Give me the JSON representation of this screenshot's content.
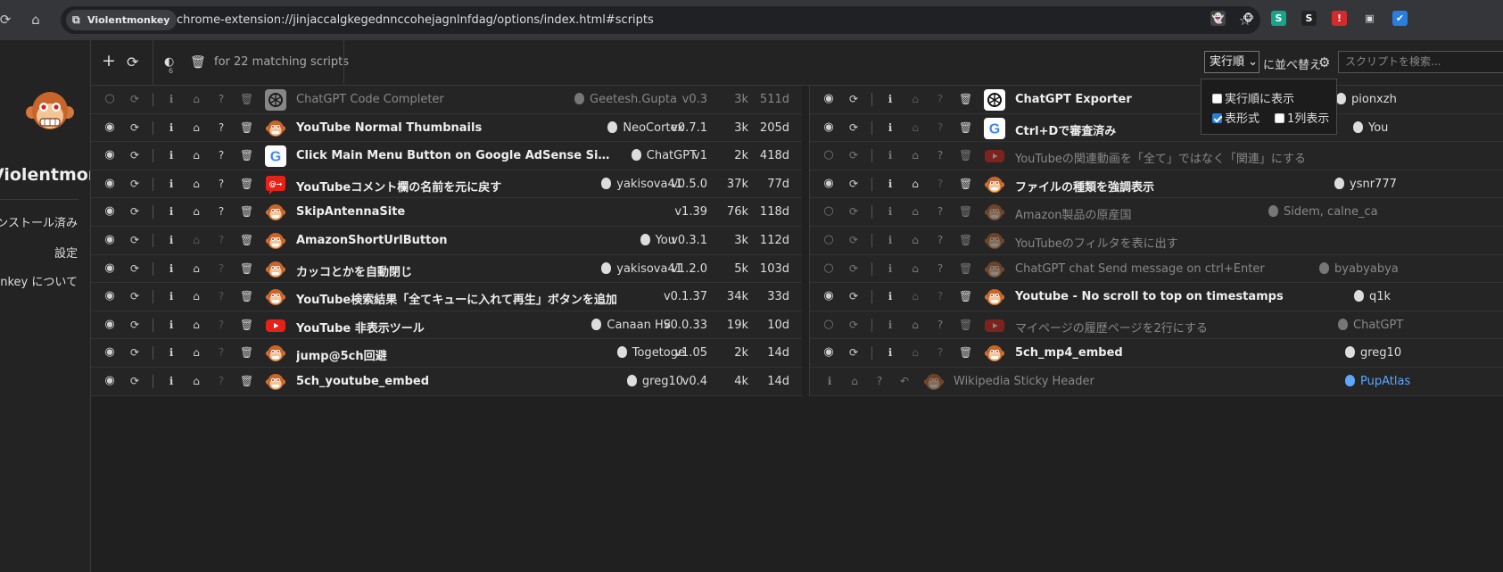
{
  "browser": {
    "site_chip": "Violentmonkey",
    "url": "chrome-extension://jinjaccalgkegednnccohejagnlnfdag/options/index.html#scripts",
    "extensions": [
      {
        "icon": "ghost-extension-icon",
        "glyph": "👻",
        "color": "#ffffff",
        "bg": "#444444"
      },
      {
        "icon": "violentmonkey-extension-icon",
        "glyph": "🐵",
        "color": "#ffffff",
        "bg": "transparent"
      },
      {
        "icon": "s-green-extension-icon",
        "glyph": "S",
        "color": "#ffffff",
        "bg": "#17a589"
      },
      {
        "icon": "s-dark-extension-icon",
        "glyph": "S",
        "color": "#ffffff",
        "bg": "#222222"
      },
      {
        "icon": "alert-red-extension-icon",
        "glyph": "!",
        "color": "#ffffff",
        "bg": "#d42a2a"
      },
      {
        "icon": "window-extension-icon",
        "glyph": "▣",
        "color": "#dddddd",
        "bg": "transparent"
      },
      {
        "icon": "check-blue-extension-icon",
        "glyph": "✔",
        "color": "#ffffff",
        "bg": "#2a7ee0"
      }
    ]
  },
  "sidebar": {
    "brand": "Violentmonkey",
    "items": [
      {
        "label": "インストール済み",
        "active": true
      },
      {
        "label": "設定",
        "active": false
      },
      {
        "label": "Violentmonkey について",
        "active": false
      }
    ]
  },
  "toolbar": {
    "badge_count": "6",
    "match_text": "for 22 matching scripts",
    "sort_value": "実行順",
    "sort_label": "に並べ替え",
    "search_placeholder": "スクリプトを検索..."
  },
  "sort_popup": {
    "show_exec_order": "実行順に表示",
    "table_format": "表形式",
    "one_column": "1列表示",
    "show_exec_order_checked": false,
    "table_format_checked": true,
    "one_column_checked": false
  },
  "scripts_left": [
    {
      "name": "ChatGPT Code Completer",
      "author": "Geetesh.Gupta",
      "version": "v0.3",
      "size": "3k",
      "age": "511d",
      "enabled": false,
      "logo": "openai-logo-icon",
      "home": false,
      "support": false
    },
    {
      "name": "YouTube Normal Thumbnails",
      "author": "NeoCortex",
      "version": "v0.7.1",
      "size": "3k",
      "age": "205d",
      "enabled": true,
      "logo": "monkey-logo-icon",
      "home": true,
      "support": true
    },
    {
      "name": "Click Main Menu Button on Google AdSense Sidebar Expa...",
      "author": "ChatGPT",
      "version": "v1",
      "size": "2k",
      "age": "418d",
      "enabled": true,
      "logo": "google-logo-icon",
      "home": true,
      "support": true
    },
    {
      "name": "YouTubeコメント欄の名前を元に戻す",
      "author": "yakisova41",
      "version": "v0.5.0",
      "size": "37k",
      "age": "77d",
      "enabled": true,
      "logo": "youtube-comment-logo-icon",
      "home": true,
      "support": true
    },
    {
      "name": "SkipAntennaSite",
      "author": "",
      "version": "v1.39",
      "size": "76k",
      "age": "118d",
      "enabled": true,
      "logo": "monkey-logo-icon",
      "home": true,
      "support": true
    },
    {
      "name": "AmazonShortUrlButton",
      "author": "You",
      "version": "v0.3.1",
      "size": "3k",
      "age": "112d",
      "enabled": true,
      "logo": "monkey-logo-icon",
      "home": false,
      "support": false
    },
    {
      "name": "カッコとかを自動閉じ",
      "author": "yakisova41",
      "version": "v1.2.0",
      "size": "5k",
      "age": "103d",
      "enabled": true,
      "logo": "monkey-logo-icon",
      "home": true,
      "support": false
    },
    {
      "name": "YouTube検索結果「全てキューに入れて再生」ボタンを追加",
      "author": "",
      "version": "v0.1.37",
      "size": "34k",
      "age": "33d",
      "enabled": true,
      "logo": "monkey-logo-icon",
      "home": true,
      "support": false
    },
    {
      "name": "YouTube 非表示ツール",
      "author": "Canaan HS",
      "version": "v0.0.33",
      "size": "19k",
      "age": "10d",
      "enabled": true,
      "logo": "youtube-logo-icon",
      "home": true,
      "support": false
    },
    {
      "name": "jump@5ch回避",
      "author": "Togetoge",
      "version": "v1.05",
      "size": "2k",
      "age": "14d",
      "enabled": true,
      "logo": "monkey-logo-icon",
      "home": true,
      "support": false
    },
    {
      "name": "5ch_youtube_embed",
      "author": "greg10",
      "version": "v0.4",
      "size": "4k",
      "age": "14d",
      "enabled": true,
      "logo": "monkey-logo-icon",
      "home": true,
      "support": false
    }
  ],
  "scripts_right": [
    {
      "name": "ChatGPT Exporter",
      "author": "pionxzh",
      "enabled": true,
      "logo": "openai-logo-icon",
      "home": false,
      "support": false
    },
    {
      "name": "Ctrl+Dで審査済み",
      "author": "You",
      "enabled": true,
      "logo": "google-logo-icon",
      "home": false,
      "support": false
    },
    {
      "name": "YouTubeの関連動画を「全て」ではなく「関連」にする",
      "author": "",
      "enabled": false,
      "logo": "youtube-logo-icon",
      "home": false,
      "support": false
    },
    {
      "name": "ファイルの種類を強調表示",
      "author": "ysnr777",
      "enabled": true,
      "logo": "monkey-logo-icon",
      "home": true,
      "support": false
    },
    {
      "name": "Amazon製品の原産国",
      "author": "Sidem, calne_ca",
      "enabled": false,
      "logo": "monkey-logo-icon",
      "home": false,
      "support": false
    },
    {
      "name": "YouTubeのフィルタを表に出す",
      "author": "",
      "enabled": false,
      "logo": "monkey-logo-icon",
      "home": true,
      "support": false
    },
    {
      "name": "ChatGPT chat Send message on ctrl+Enter",
      "author": "byabyabya",
      "enabled": false,
      "logo": "monkey-logo-icon",
      "home": false,
      "support": false
    },
    {
      "name": "Youtube - No scroll to top on timestamps",
      "author": "q1k",
      "enabled": true,
      "logo": "monkey-logo-icon",
      "home": false,
      "support": false
    },
    {
      "name": "マイページの履歴ページを2行にする",
      "author": "ChatGPT",
      "enabled": false,
      "logo": "youtube-logo-icon",
      "home": false,
      "support": false
    },
    {
      "name": "5ch_mp4_embed",
      "author": "greg10",
      "enabled": true,
      "logo": "monkey-logo-icon",
      "home": false,
      "support": false
    },
    {
      "name": "Wikipedia Sticky Header",
      "author": "PupAtlas",
      "enabled": false,
      "logo": "monkey-logo-icon",
      "home": false,
      "support": false,
      "removed": true
    }
  ],
  "colors": {
    "accent": "#2a7ee0",
    "link": "#5ca7ff"
  }
}
